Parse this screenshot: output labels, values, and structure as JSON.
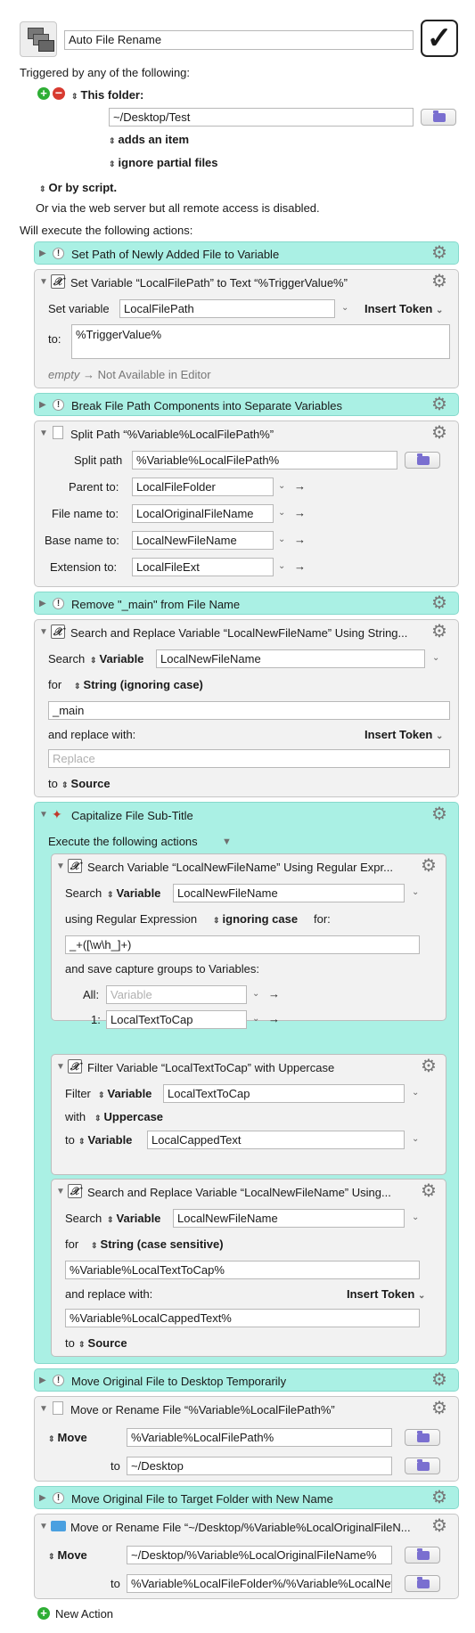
{
  "macro": {
    "name": "Auto File Rename",
    "enabled": true
  },
  "triggers": {
    "heading": "Triggered by any of the following:",
    "folder_label": "This folder:",
    "folder_path": "~/Desktop/Test",
    "adds_item": "adds an item",
    "ignore_partial": "ignore partial files",
    "or_script": "Or by script.",
    "web_server_note": "Or via the web server but all remote access is disabled."
  },
  "actions_heading": "Will execute the following actions:",
  "actions": {
    "a1": {
      "title": "Set Path of Newly Added File to Variable"
    },
    "a2": {
      "title": "Set Variable “LocalFilePath” to Text “%TriggerValue%”",
      "set_variable_label": "Set variable",
      "variable": "LocalFilePath",
      "insert_token": "Insert Token",
      "to_label": "to:",
      "text": "%TriggerValue%",
      "status_empty": "empty",
      "status_rest": "→ Not Available in Editor"
    },
    "a3": {
      "title": "Break File Path Components into Separate Variables"
    },
    "a4": {
      "title": "Split Path “%Variable%LocalFilePath%”",
      "split_path_label": "Split path",
      "split_path": "%Variable%LocalFilePath%",
      "parent_label": "Parent to:",
      "parent": "LocalFileFolder",
      "filename_label": "File name to:",
      "filename": "LocalOriginalFileName",
      "basename_label": "Base name to:",
      "basename": "LocalNewFileName",
      "extension_label": "Extension to:",
      "extension": "LocalFileExt"
    },
    "a5": {
      "title": "Remove \"_main\" from File Name"
    },
    "a6": {
      "title": "Search and Replace Variable “LocalNewFileName” Using String...",
      "search_label": "Search",
      "search_kind": "Variable",
      "search_var": "LocalNewFileName",
      "for_label": "for",
      "for_kind": "String (ignoring case)",
      "search_text": "_main",
      "replace_label": "and replace with:",
      "insert_token": "Insert Token",
      "replace_placeholder": "Replace",
      "to_label": "to",
      "to_kind": "Source"
    },
    "a7": {
      "title": "Capitalize File Sub-Title",
      "execute_label": "Execute the following actions",
      "sub1": {
        "title": "Search Variable “LocalNewFileName” Using Regular Expr...",
        "search_label": "Search",
        "search_kind": "Variable",
        "search_var": "LocalNewFileName",
        "using_label": "using Regular Expression",
        "case_kind": "ignoring case",
        "for_label": "for:",
        "regex": "_+([\\w\\h_]+)",
        "capture_label": "and save capture groups to Variables:",
        "all_label": "All:",
        "all_placeholder": "Variable",
        "one_label": "1:",
        "one_var": "LocalTextToCap"
      },
      "sub2": {
        "title": "Filter Variable “LocalTextToCap” with Uppercase",
        "filter_label": "Filter",
        "filter_kind": "Variable",
        "filter_var": "LocalTextToCap",
        "with_label": "with",
        "with_kind": "Uppercase",
        "to_label": "to",
        "to_kind": "Variable",
        "to_var": "LocalCappedText"
      },
      "sub3": {
        "title": "Search and Replace Variable “LocalNewFileName” Using...",
        "search_label": "Search",
        "search_kind": "Variable",
        "search_var": "LocalNewFileName",
        "for_label": "for",
        "for_kind": "String (case sensitive)",
        "search_text": "%Variable%LocalTextToCap%",
        "replace_label": "and replace with:",
        "insert_token": "Insert Token",
        "replace_text": "%Variable%LocalCappedText%",
        "to_label": "to",
        "to_kind": "Source"
      }
    },
    "a8": {
      "title": "Move Original File to Desktop Temporarily"
    },
    "a9": {
      "title": "Move or Rename File “%Variable%LocalFilePath%”",
      "move_label": "Move",
      "source": "%Variable%LocalFilePath%",
      "to_label": "to",
      "dest": "~/Desktop"
    },
    "a10": {
      "title": "Move Original File to Target Folder with New Name"
    },
    "a11": {
      "title": "Move or Rename File “~/Desktop/%Variable%LocalOriginalFileN...",
      "move_label": "Move",
      "source": "~/Desktop/%Variable%LocalOriginalFileName%",
      "to_label": "to",
      "dest": "%Variable%LocalFileFolder%/%Variable%LocalNewFileName%.%Variable%LocalFileExt%"
    }
  },
  "new_action": "New Action",
  "colors": {
    "comment_bg": "#aaf0e4",
    "action_bg": "#f2f2f2",
    "folder_icon": "#7a6fd0",
    "add_green": "#2eae35",
    "remove_red": "#d83a30"
  }
}
